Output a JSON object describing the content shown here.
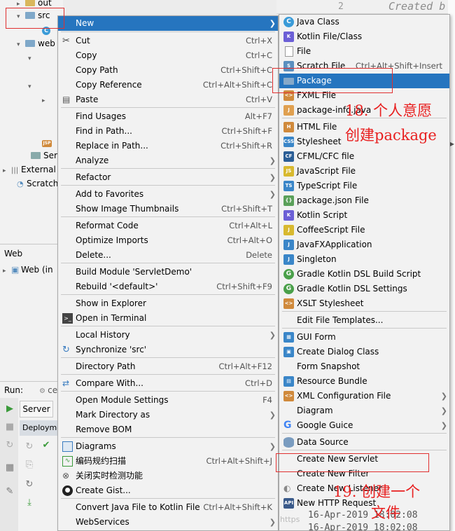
{
  "tree": {
    "out": "out",
    "src": "src",
    "web": "web",
    "servlet_item": "Serv",
    "external": "External",
    "scratches": "Scratche"
  },
  "web_panel": {
    "title": "Web",
    "item": "Web (in"
  },
  "run_panel": {
    "label": "Run:",
    "tab": "ce",
    "server_tab": "Server",
    "deployment": "Deploymen"
  },
  "editor": {
    "line_number": "2",
    "comment": "Created b"
  },
  "context_menu": [
    {
      "label": "New",
      "shortcut": "",
      "submenu": true,
      "selected": true,
      "icon": ""
    },
    {
      "label": "Cut",
      "shortcut": "Ctrl+X",
      "icon": "scissors-icon"
    },
    {
      "label": "Copy",
      "shortcut": "Ctrl+C",
      "icon": ""
    },
    {
      "label": "Copy Path",
      "shortcut": "Ctrl+Shift+C",
      "icon": ""
    },
    {
      "label": "Copy Reference",
      "shortcut": "Ctrl+Alt+Shift+C",
      "icon": ""
    },
    {
      "label": "Paste",
      "shortcut": "Ctrl+V",
      "icon": "clipboard-icon"
    },
    {
      "label": "Find Usages",
      "shortcut": "Alt+F7",
      "icon": ""
    },
    {
      "label": "Find in Path...",
      "shortcut": "Ctrl+Shift+F",
      "icon": ""
    },
    {
      "label": "Replace in Path...",
      "shortcut": "Ctrl+Shift+R",
      "icon": ""
    },
    {
      "label": "Analyze",
      "shortcut": "",
      "submenu": true,
      "icon": ""
    },
    {
      "label": "Refactor",
      "shortcut": "",
      "submenu": true,
      "icon": ""
    },
    {
      "label": "Add to Favorites",
      "shortcut": "",
      "submenu": true,
      "icon": ""
    },
    {
      "label": "Show Image Thumbnails",
      "shortcut": "Ctrl+Shift+T",
      "icon": ""
    },
    {
      "label": "Reformat Code",
      "shortcut": "Ctrl+Alt+L",
      "icon": ""
    },
    {
      "label": "Optimize Imports",
      "shortcut": "Ctrl+Alt+O",
      "icon": ""
    },
    {
      "label": "Delete...",
      "shortcut": "Delete",
      "icon": ""
    },
    {
      "label": "Build Module 'ServletDemo'",
      "shortcut": "",
      "icon": ""
    },
    {
      "label": "Rebuild '<default>'",
      "shortcut": "Ctrl+Shift+F9",
      "icon": ""
    },
    {
      "label": "Show in Explorer",
      "shortcut": "",
      "icon": ""
    },
    {
      "label": "Open in Terminal",
      "shortcut": "",
      "icon": "terminal-icon"
    },
    {
      "label": "Local History",
      "shortcut": "",
      "submenu": true,
      "icon": ""
    },
    {
      "label": "Synchronize 'src'",
      "shortcut": "",
      "icon": "sync-icon"
    },
    {
      "label": "Directory Path",
      "shortcut": "Ctrl+Alt+F12",
      "icon": ""
    },
    {
      "label": "Compare With...",
      "shortcut": "Ctrl+D",
      "icon": "compare-icon"
    },
    {
      "label": "Open Module Settings",
      "shortcut": "F4",
      "icon": ""
    },
    {
      "label": "Mark Directory as",
      "shortcut": "",
      "submenu": true,
      "icon": ""
    },
    {
      "label": "Remove BOM",
      "shortcut": "",
      "icon": ""
    },
    {
      "label": "Diagrams",
      "shortcut": "",
      "submenu": true,
      "icon": "diagram-icon"
    },
    {
      "label": "编码规约扫描",
      "shortcut": "Ctrl+Alt+Shift+J",
      "icon": "scan-icon"
    },
    {
      "label": "关闭实时检测功能",
      "shortcut": "",
      "icon": "detect-icon"
    },
    {
      "label": "Create Gist...",
      "shortcut": "",
      "icon": "github-icon"
    },
    {
      "label": "Convert Java File to Kotlin File",
      "shortcut": "Ctrl+Alt+Shift+K",
      "icon": ""
    },
    {
      "label": "WebServices",
      "shortcut": "",
      "submenu": true,
      "icon": ""
    }
  ],
  "new_submenu": [
    {
      "label": "Java Class",
      "shortcut": "",
      "icon": "java-class-icon",
      "color": "#3a9bd8"
    },
    {
      "label": "Kotlin File/Class",
      "shortcut": "",
      "icon": "kotlin-icon",
      "color": "#6b5fd6"
    },
    {
      "label": "File",
      "shortcut": "",
      "icon": "file-icon",
      "color": "#888888"
    },
    {
      "label": "Scratch File",
      "shortcut": "Ctrl+Alt+Shift+Insert",
      "icon": "scratch-icon",
      "color": "#5a8fbf"
    },
    {
      "label": "Package",
      "shortcut": "",
      "icon": "package-icon",
      "color": "#86a9c9",
      "selected": true
    },
    {
      "label": "FXML File",
      "shortcut": "",
      "icon": "fxml-icon",
      "color": "#d08a3c"
    },
    {
      "label": "package-info.java",
      "shortcut": "",
      "icon": "java-file-icon",
      "color": "#e0a050"
    },
    {
      "label": "HTML File",
      "shortcut": "",
      "icon": "html-icon",
      "color": "#d08a3c"
    },
    {
      "label": "Stylesheet",
      "shortcut": "",
      "icon": "css-icon",
      "color": "#3a86c8"
    },
    {
      "label": "CFML/CFC file",
      "shortcut": "",
      "icon": "cfml-icon",
      "color": "#2b5e96"
    },
    {
      "label": "JavaScript File",
      "shortcut": "",
      "icon": "js-icon",
      "color": "#d8b92f"
    },
    {
      "label": "TypeScript File",
      "shortcut": "",
      "icon": "ts-icon",
      "color": "#3a86c8"
    },
    {
      "label": "package.json File",
      "shortcut": "",
      "icon": "npm-icon",
      "color": "#5aa05a"
    },
    {
      "label": "Kotlin Script",
      "shortcut": "",
      "icon": "kotlin-script-icon",
      "color": "#6b5fd6"
    },
    {
      "label": "CoffeeScript File",
      "shortcut": "",
      "icon": "coffee-icon",
      "color": "#d8b92f"
    },
    {
      "label": "JavaFXApplication",
      "shortcut": "",
      "icon": "javafx-icon",
      "color": "#3a86c8"
    },
    {
      "label": "Singleton",
      "shortcut": "",
      "icon": "singleton-icon",
      "color": "#3a86c8"
    },
    {
      "label": "Gradle Kotlin DSL Build Script",
      "shortcut": "",
      "icon": "gradle-icon",
      "color": "#4aa04a"
    },
    {
      "label": "Gradle Kotlin DSL Settings",
      "shortcut": "",
      "icon": "gradle-icon",
      "color": "#4aa04a"
    },
    {
      "label": "XSLT Stylesheet",
      "shortcut": "",
      "icon": "xslt-icon",
      "color": "#d08a3c"
    },
    {
      "label": "Edit File Templates...",
      "shortcut": "",
      "icon": ""
    },
    {
      "label": "GUI Form",
      "shortcut": "",
      "icon": "gui-form-icon",
      "color": "#3a86c8"
    },
    {
      "label": "Create Dialog Class",
      "shortcut": "",
      "icon": "dialog-icon",
      "color": "#3a86c8"
    },
    {
      "label": "Form Snapshot",
      "shortcut": "",
      "icon": ""
    },
    {
      "label": "Resource Bundle",
      "shortcut": "",
      "icon": "bundle-icon",
      "color": "#3a86c8"
    },
    {
      "label": "XML Configuration File",
      "shortcut": "",
      "submenu": true,
      "icon": "xml-icon",
      "color": "#d08a3c"
    },
    {
      "label": "Diagram",
      "shortcut": "",
      "submenu": true,
      "icon": ""
    },
    {
      "label": "Google Guice",
      "shortcut": "",
      "submenu": true,
      "icon": "google-icon",
      "color": "#4285f4"
    },
    {
      "label": "Data Source",
      "shortcut": "",
      "icon": "database-icon",
      "color": "#7a9cc0"
    },
    {
      "label": "Create New Servlet",
      "shortcut": "",
      "icon": ""
    },
    {
      "label": "Create New Filter",
      "shortcut": "",
      "icon": ""
    },
    {
      "label": "Create New Listener",
      "shortcut": "",
      "icon": "listener-icon",
      "color": "#888888"
    },
    {
      "label": "New HTTP Request",
      "shortcut": "",
      "icon": "api-icon",
      "color": "#3a5a8a"
    }
  ],
  "annotations": {
    "a18_line1": "18. 个人意愿",
    "a18_line2": "创建package",
    "a19_line1": "19. 创建一个",
    "a19_line2": "文件"
  },
  "status": {
    "line1": "16-Apr-2019 18:02:08",
    "line2": "16-Apr-2019 18:02:08",
    "watermark": "https"
  }
}
